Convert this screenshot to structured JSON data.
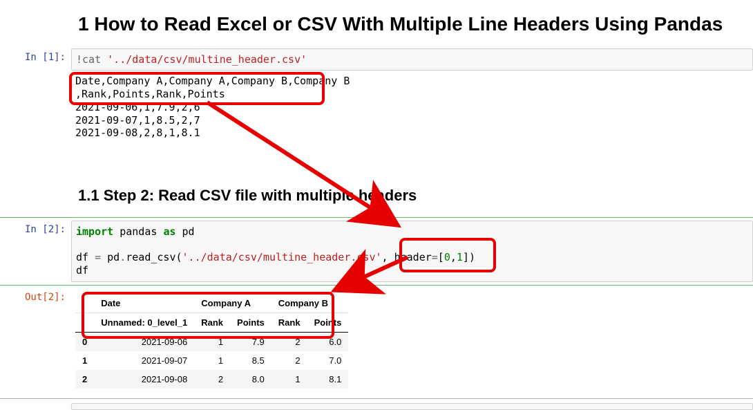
{
  "heading1": "1  How to Read Excel or CSV With Multiple Line Headers Using Pandas",
  "cell1": {
    "prompt": "In [1]:",
    "code_prefix": "!cat ",
    "code_path": "'../data/csv/multine_header.csv'",
    "output_line1": "Date,Company A,Company A,Company B,Company B",
    "output_line2": ",Rank,Points,Rank,Points",
    "output_line3": "2021-09-06,1,7.9,2,6",
    "output_line4": "2021-09-07,1,8.5,2,7",
    "output_line5": "2021-09-08,2,8,1,8.1"
  },
  "heading2": "1.1  Step 2: Read CSV file with multiple headers",
  "cell2": {
    "prompt_in": "In [2]:",
    "prompt_out": "Out[2]:",
    "kw_import": "import",
    "mod": " pandas ",
    "kw_as": "as",
    "alias": " pd",
    "line2_a": "df ",
    "line2_eq": "=",
    "line2_b": " pd",
    "line2_dot": ".",
    "line2_c": "read_csv(",
    "line2_path": "'../data/csv/multine_header.csv'",
    "line2_comma": ", ",
    "line2_header_kw": "header",
    "line2_eq2": "=",
    "line2_br1": "[",
    "line2_n0": "0",
    "line2_c2": ",",
    "line2_n1": "1",
    "line2_br2": "])",
    "line3": "df"
  },
  "table": {
    "top": [
      "",
      "Date",
      "Company A",
      "Company A",
      "Company B",
      "Company B"
    ],
    "sub": [
      "",
      "Unnamed: 0_level_1",
      "Rank",
      "Points",
      "Rank",
      "Points"
    ],
    "rows": [
      {
        "idx": "0",
        "c": [
          "2021-09-06",
          "1",
          "7.9",
          "2",
          "6.0"
        ]
      },
      {
        "idx": "1",
        "c": [
          "2021-09-07",
          "1",
          "8.5",
          "2",
          "7.0"
        ]
      },
      {
        "idx": "2",
        "c": [
          "2021-09-08",
          "2",
          "8.0",
          "1",
          "8.1"
        ]
      }
    ]
  },
  "chart_data": {
    "type": "table",
    "columns_top": [
      "Date",
      "Company A",
      "Company A",
      "Company B",
      "Company B"
    ],
    "columns_bottom": [
      "Unnamed: 0_level_1",
      "Rank",
      "Points",
      "Rank",
      "Points"
    ],
    "index": [
      0,
      1,
      2
    ],
    "data": [
      [
        "2021-09-06",
        1,
        7.9,
        2,
        6.0
      ],
      [
        "2021-09-07",
        1,
        8.5,
        2,
        7.0
      ],
      [
        "2021-09-08",
        2,
        8.0,
        1,
        8.1
      ]
    ]
  }
}
